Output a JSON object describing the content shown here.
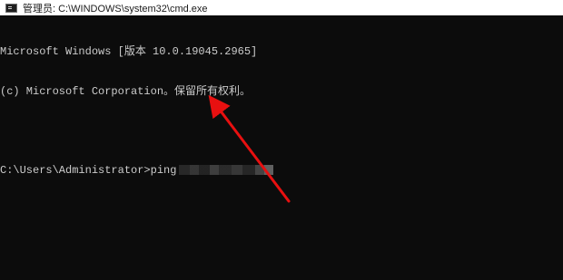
{
  "window": {
    "title": "管理员: C:\\WINDOWS\\system32\\cmd.exe"
  },
  "console": {
    "lines": [
      "Microsoft Windows [版本 10.0.19045.2965]",
      "(c) Microsoft Corporation。保留所有权利。",
      ""
    ],
    "prompt": "C:\\Users\\Administrator>",
    "command": "ping"
  },
  "colors": {
    "console_background": "#0c0c0c",
    "console_text": "#cccccc",
    "titlebar_background": "#ffffff",
    "annotation_arrow": "#e81010"
  },
  "icons": {
    "app_icon": "cmd-console-icon",
    "annotation": "red-arrow-annotation"
  }
}
